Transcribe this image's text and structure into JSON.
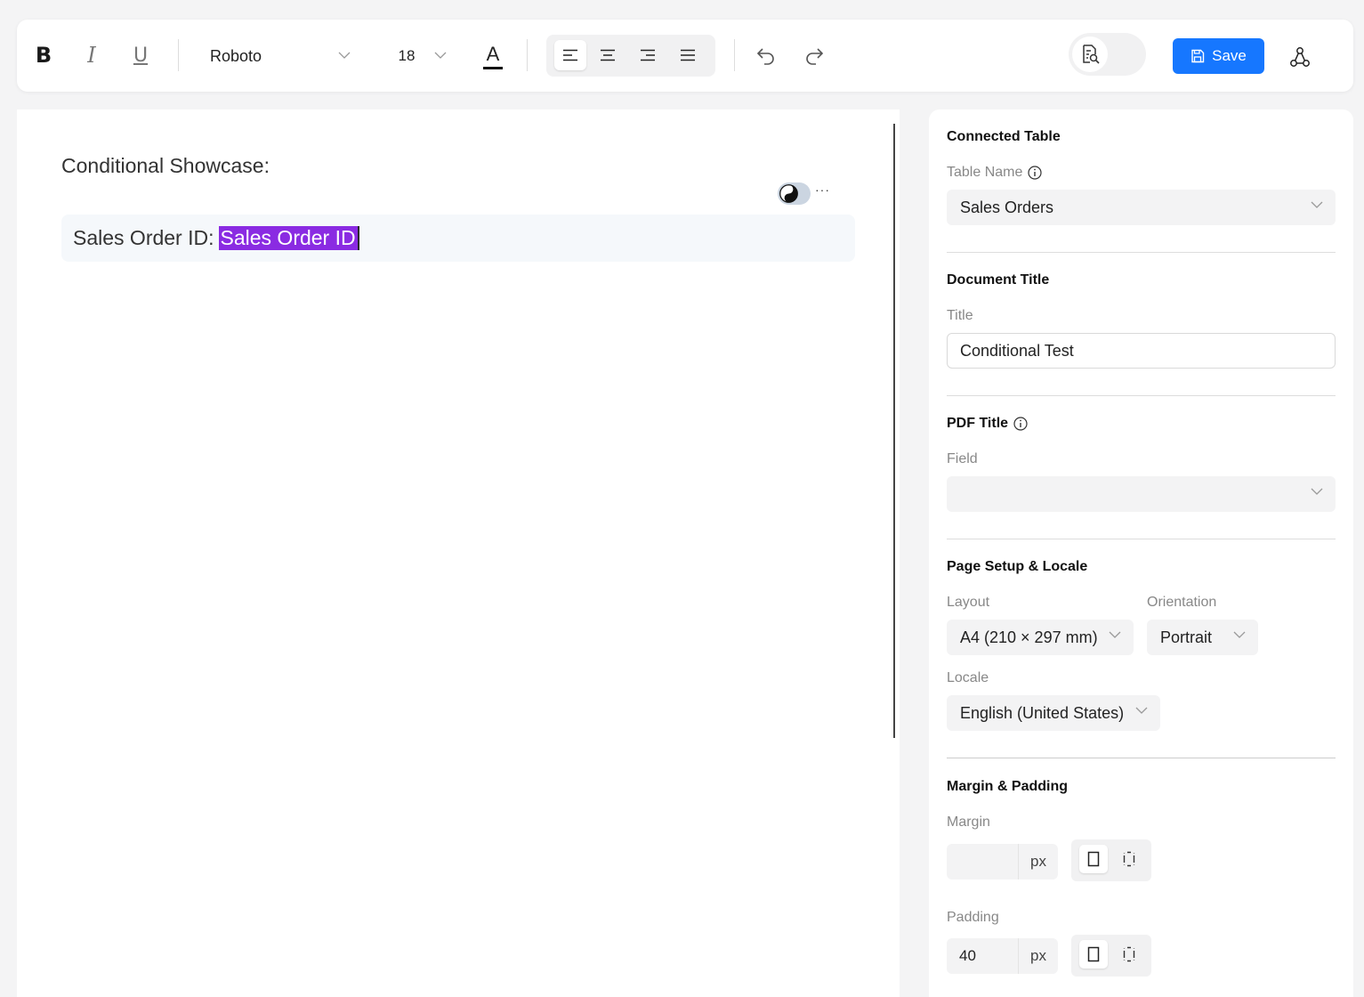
{
  "toolbar": {
    "bold_label": "B",
    "italic_label": "I",
    "underline_label": "U",
    "font_family": "Roboto",
    "font_size": "18",
    "text_color_label": "A",
    "save_label": "Save",
    "accent_color": "#1677ff"
  },
  "editor": {
    "heading": "Conditional Showcase:",
    "block_label": "Sales Order ID:",
    "field_chip": "Sales Order ID",
    "chip_color": "#8a2be2",
    "more_label": "···"
  },
  "panel": {
    "connected_table": {
      "title": "Connected Table",
      "table_name_label": "Table Name",
      "table_name_value": "Sales Orders"
    },
    "document_title": {
      "title": "Document Title",
      "title_label": "Title",
      "title_value": "Conditional Test"
    },
    "pdf_title": {
      "title": "PDF Title",
      "field_label": "Field",
      "field_value": ""
    },
    "page_setup": {
      "title": "Page Setup & Locale",
      "layout_label": "Layout",
      "layout_value": "A4 (210 × 297 mm)",
      "orientation_label": "Orientation",
      "orientation_value": "Portrait",
      "locale_label": "Locale",
      "locale_value": "English (United States)"
    },
    "margin_padding": {
      "title": "Margin & Padding",
      "margin_label": "Margin",
      "margin_value": "",
      "margin_unit": "px",
      "padding_label": "Padding",
      "padding_value": "40",
      "padding_unit": "px"
    }
  }
}
